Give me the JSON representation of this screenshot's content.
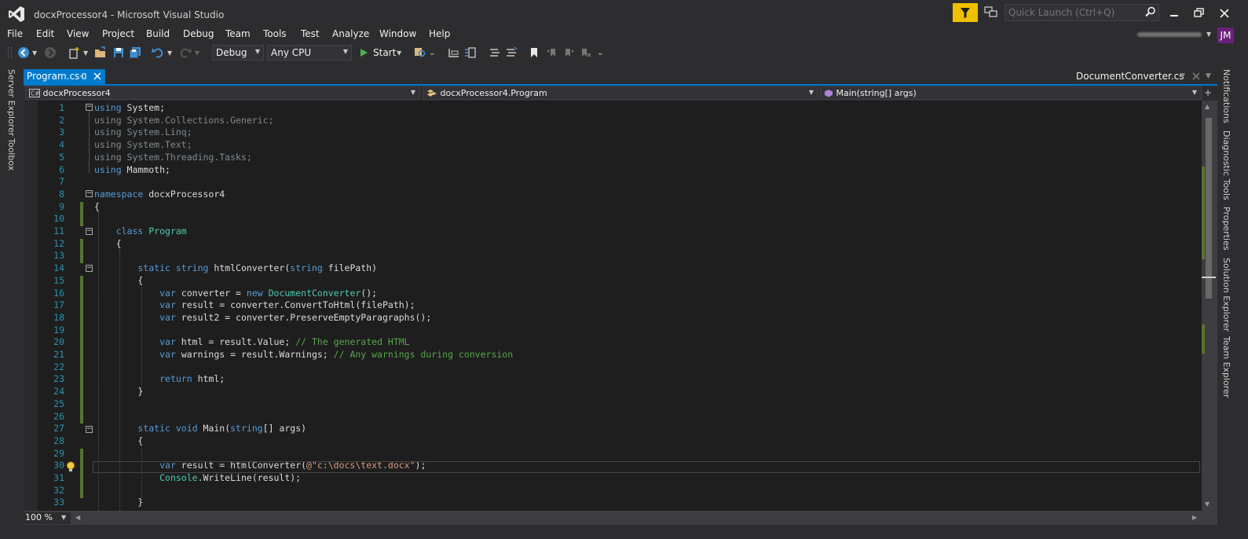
{
  "window": {
    "title": "docxProcessor4 - Microsoft Visual Studio"
  },
  "quick_launch": {
    "placeholder": "Quick Launch (Ctrl+Q)"
  },
  "menu": [
    "File",
    "Edit",
    "View",
    "Project",
    "Build",
    "Debug",
    "Team",
    "Tools",
    "Test",
    "Analyze",
    "Window",
    "Help"
  ],
  "user": {
    "initials": "JM"
  },
  "toolbar": {
    "config": "Debug",
    "platform": "Any CPU",
    "start_label": "Start"
  },
  "left_tabs": [
    "Server Explorer",
    "Toolbox"
  ],
  "right_tabs": [
    "Notifications",
    "Diagnostic Tools",
    "Properties",
    "Solution Explorer",
    "Team Explorer"
  ],
  "tabs": {
    "active": "Program.cs",
    "other": "DocumentConverter.cs"
  },
  "nav": {
    "project": "docxProcessor4",
    "class": "docxProcessor4.Program",
    "member": "Main(string[] args)"
  },
  "zoom": "100 %",
  "code": [
    {
      "n": "1",
      "t": "using System;"
    },
    {
      "n": "2",
      "t": "using System.Collections.Generic;"
    },
    {
      "n": "3",
      "t": "using System.Linq;"
    },
    {
      "n": "4",
      "t": "using System.Text;"
    },
    {
      "n": "5",
      "t": "using System.Threading.Tasks;"
    },
    {
      "n": "6",
      "t": "using Mammoth;"
    },
    {
      "n": "7",
      "t": ""
    },
    {
      "n": "8",
      "t": "namespace docxProcessor4"
    },
    {
      "n": "9",
      "t": "{"
    },
    {
      "n": "10",
      "t": ""
    },
    {
      "n": "11",
      "t": "    class Program"
    },
    {
      "n": "12",
      "t": "    {"
    },
    {
      "n": "13",
      "t": ""
    },
    {
      "n": "14",
      "t": "        static string htmlConverter(string filePath)"
    },
    {
      "n": "15",
      "t": "        {"
    },
    {
      "n": "16",
      "t": "            var converter = new DocumentConverter();"
    },
    {
      "n": "17",
      "t": "            var result = converter.ConvertToHtml(filePath);"
    },
    {
      "n": "18",
      "t": "            var result2 = converter.PreserveEmptyParagraphs();"
    },
    {
      "n": "19",
      "t": ""
    },
    {
      "n": "20",
      "t": "            var html = result.Value; // The generated HTML"
    },
    {
      "n": "21",
      "t": "            var warnings = result.Warnings; // Any warnings during conversion"
    },
    {
      "n": "22",
      "t": ""
    },
    {
      "n": "23",
      "t": "            return html;"
    },
    {
      "n": "24",
      "t": "        }"
    },
    {
      "n": "25",
      "t": ""
    },
    {
      "n": "26",
      "t": ""
    },
    {
      "n": "27",
      "t": "        static void Main(string[] args)"
    },
    {
      "n": "28",
      "t": "        {"
    },
    {
      "n": "29",
      "t": ""
    },
    {
      "n": "30",
      "t": "            var result = htmlConverter(@\"c:\\docs\\text.docx\");"
    },
    {
      "n": "31",
      "t": "            Console.WriteLine(result);"
    },
    {
      "n": "32",
      "t": ""
    },
    {
      "n": "33",
      "t": "        }"
    }
  ]
}
